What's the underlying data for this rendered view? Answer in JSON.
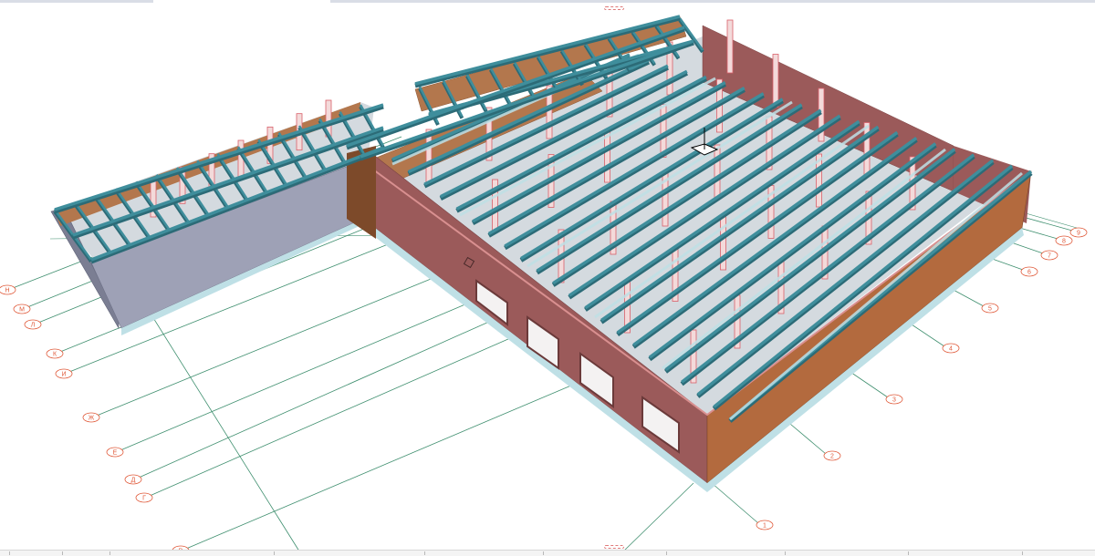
{
  "viewport": {
    "type": "3d-model-view",
    "background": "#ffffff"
  },
  "colors": {
    "grid_line": "#3f8f6f",
    "grid_bubble": "#e05a3a",
    "roof_beam": "#3f8e9c",
    "roof_beam_dark": "#2c6b77",
    "brick_wall": "#9b5a5a",
    "brick_wall_dark": "#7d4545",
    "interior_wall": "#b3774d",
    "annex_wall": "#9ea1b6",
    "annex_wall_dark": "#7b7e93",
    "floor_slab": "#d4dadf",
    "column_outline": "#d9606a"
  },
  "grid_axes": {
    "left": [
      "Н",
      "М",
      "Л",
      "К",
      "И",
      "Ж",
      "Е",
      "Д",
      "Г",
      "В"
    ],
    "right": [
      "9",
      "8",
      "7",
      "6",
      "5",
      "4",
      "3",
      "2",
      "1"
    ]
  },
  "navigation": {
    "top_handle": "view-rotate-handle-top",
    "bottom_handle": "view-rotate-handle-bottom"
  }
}
